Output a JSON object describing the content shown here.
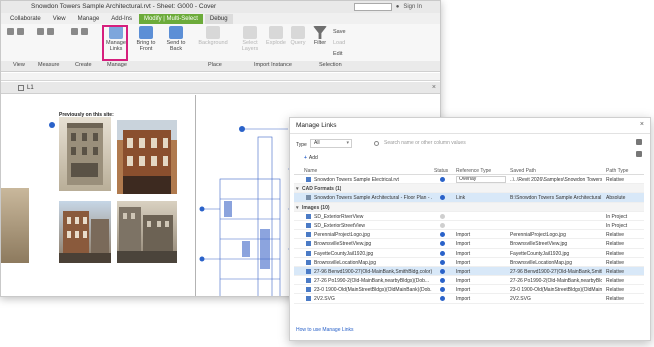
{
  "window": {
    "title": "Snowdon Towers Sample Architectural.rvt - Sheet: G000 - Cover",
    "sign_in": "Sign In"
  },
  "ribbon": {
    "tabs": [
      "Collaborate",
      "View",
      "Manage",
      "Add-Ins",
      "Modify | Multi-Select",
      "Debug"
    ],
    "buttons": {
      "manage_links": "Manage Links",
      "bring_to_front": "Bring to Front",
      "send_to_back": "Send to Back",
      "background": "Background",
      "select_layers": "Select Layers",
      "explode": "Explode",
      "query": "Query",
      "filter": "Filter",
      "save": "Save",
      "load": "Load",
      "edit": "Edit"
    },
    "panels": [
      "View",
      "Measure",
      "Create",
      "Manage",
      "Place",
      "Import Instance",
      "Selection"
    ]
  },
  "view_tab": {
    "label": "L1"
  },
  "sheet": {
    "previously_label": "Previously on this site:"
  },
  "dialog": {
    "title": "Manage Links",
    "type_label": "Type",
    "type_value": "All",
    "search_placeholder": "Search name or other column values",
    "add_label": "Add",
    "columns": [
      "Name",
      "Status",
      "Reference Type",
      "Saved Path",
      "Path Type"
    ],
    "rows": [
      {
        "name": "Snowdon Towers Sample Electrical.rvt",
        "status": "ok",
        "ref": "Overlay",
        "path": "..\\..\\Revit 2026\\Samples\\Snowdon Towers Sample Electrical.rvt",
        "ptype": "Relative",
        "kind": "file",
        "dropdown": true
      },
      {
        "name": "CAD Formats (1)",
        "group": true
      },
      {
        "name": "Snowdon Towers Sample Architectural - Floor Plan - ...",
        "status": "ok",
        "ref": "Link",
        "path": "B:\\Snowdon Towers Sample Architectural - F...",
        "ptype": "Absolute",
        "kind": "cad",
        "selected": true
      },
      {
        "name": "Images (10)",
        "group": true
      },
      {
        "name": "SD_ExteriorRiverView",
        "status": "none",
        "ref": "",
        "path": "",
        "ptype": "In Project",
        "kind": "file"
      },
      {
        "name": "SD_ExteriorStreetView",
        "status": "none",
        "ref": "",
        "path": "",
        "ptype": "In Project",
        "kind": "file"
      },
      {
        "name": "PerennialProjectLogo.jpg",
        "status": "ok",
        "ref": "Import",
        "path": "PerennialProjectLogo.jpg",
        "ptype": "Relative",
        "kind": "file"
      },
      {
        "name": "BrownsvilleStreetView.jpg",
        "status": "ok",
        "ref": "Import",
        "path": "BrownsvilleStreetView.jpg",
        "ptype": "Relative",
        "kind": "file"
      },
      {
        "name": "FayetteCountyJail1920.jpg",
        "status": "ok",
        "ref": "Import",
        "path": "FayetteCountyJail1920.jpg",
        "ptype": "Relative",
        "kind": "file"
      },
      {
        "name": "BrownsvilleLocationMap.jpg",
        "status": "ok",
        "ref": "Import",
        "path": "BrownsvilleLocationMap.jpg",
        "ptype": "Relative",
        "kind": "file"
      },
      {
        "name": "27-96 Berwd1900-27(Old-MainBank,SmithBldg,color)(Dob...",
        "status": "ok",
        "ref": "Import",
        "path": "27-96 Berwd1900-27(Old-MainBank,SmithBldg,c...",
        "ptype": "Relative",
        "kind": "file",
        "selected": true
      },
      {
        "name": "27-26 Po1990-2(Old-MainBank,nearbyBldgs)(Dob...",
        "status": "ok",
        "ref": "Import",
        "path": "27-26 Po1990-2(Old-MainBank,nearbyBldgs)(Dob...",
        "ptype": "Relative",
        "kind": "file"
      },
      {
        "name": "23-0 1900-Old(MainStreetBldgs)(OldMainBank)(Dob...",
        "status": "ok",
        "ref": "Import",
        "path": "23-0 1900-Old(MainStreetBldgs)(OldMainBank)(D...",
        "ptype": "Relative",
        "kind": "file"
      },
      {
        "name": "2V2.SVG",
        "status": "ok",
        "ref": "Import",
        "path": "2V2.SVG",
        "ptype": "Relative",
        "kind": "file"
      }
    ],
    "help_link": "How to use Manage Links"
  },
  "colors": {
    "modify_tab": "#6cab3a",
    "highlight": "#d61f7d",
    "accent": "#2a62c9"
  }
}
